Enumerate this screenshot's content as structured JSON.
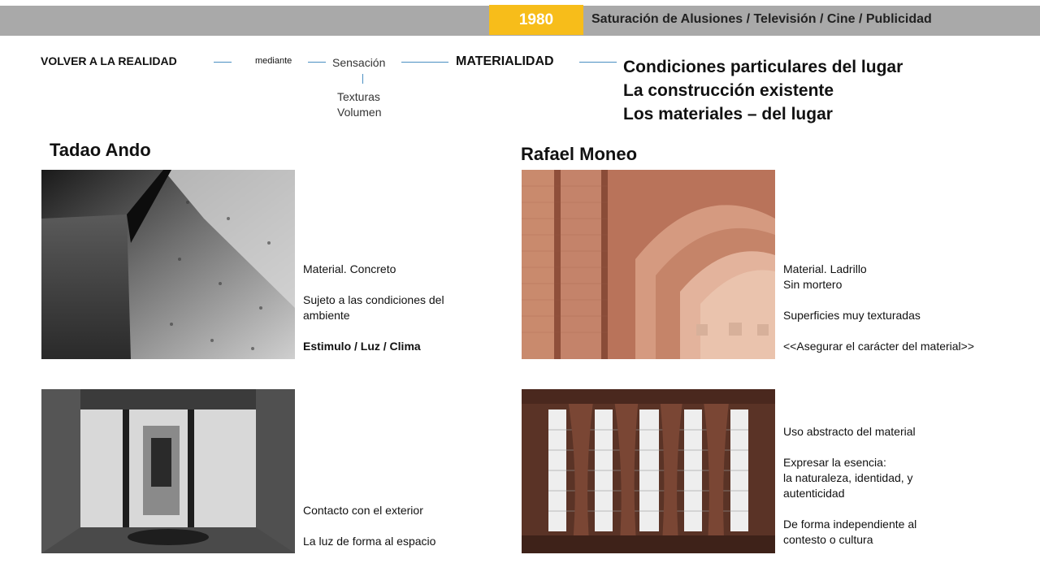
{
  "header": {
    "year": "1980",
    "title": "Saturación de Alusiones / Televisión / Cine / Publicidad"
  },
  "flow": {
    "volver": "VOLVER A LA REALIDAD",
    "mediante": "mediante",
    "sensacion": "Sensación",
    "texturas": "Texturas",
    "volumen": "Volumen",
    "materialidad": "MATERIALIDAD",
    "conditions": [
      "Condiciones particulares del lugar",
      "La construcción existente",
      "Los materiales – del lugar"
    ]
  },
  "ando": {
    "name": "Tadao Ando",
    "caption1": {
      "material": "Material. Concreto",
      "subject_l1": "Sujeto a las condiciones del",
      "subject_l2": "ambiente",
      "stimulus": "Estimulo / Luz / Clima"
    },
    "caption2": {
      "contact": "Contacto con el exterior",
      "light": "La luz de forma al espacio"
    }
  },
  "moneo": {
    "name": "Rafael Moneo",
    "caption1": {
      "material": "Material. Ladrillo",
      "mortar": "Sin mortero",
      "surfaces": "Superficies muy texturadas",
      "quote": "<<Asegurar el carácter del material>>"
    },
    "caption2": {
      "use": "Uso abstracto del material",
      "express": "Expresar la esencia:",
      "nature": "la naturaleza, identidad, y",
      "authenticity": "autenticidad",
      "form_l1": "De forma independiente al",
      "form_l2": "contesto o cultura"
    }
  },
  "colors": {
    "bar": "#a9a9a9",
    "badge": "#f7bd1a",
    "connector": "#4a8fc2"
  }
}
